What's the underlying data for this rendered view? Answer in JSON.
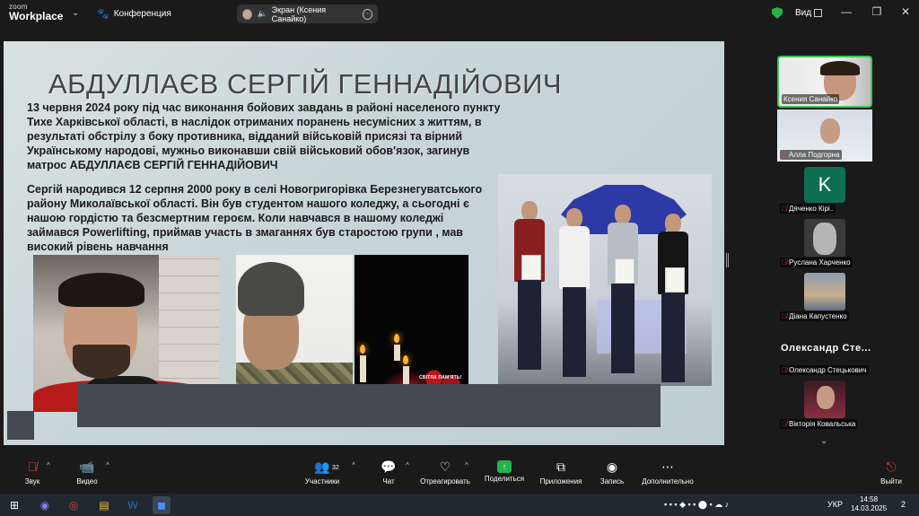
{
  "titlebar": {
    "logo_top": "zoom",
    "logo_bottom": "Workplace",
    "meeting_label": "Конференция",
    "share_label": "Экран (Ксения Санайко)",
    "view_label": "Вид"
  },
  "slide": {
    "title": "АБДУЛЛАЄВ СЕРГІЙ ГЕННАДІЙОВИЧ",
    "paragraph1": "13 червня 2024 року під час виконання бойових завдань в районі населеного пункту Тихе Харківської області,  в наслідок отриманих поранень несумісних з життям, в результаті обстрілу з боку противника, відданий військовій присязі та вірний Українському народові, мужньо виконавши свій військовий обов'язок, загинув матрос АБДУЛЛАЄВ СЕРГІЙ ГЕННАДІЙОВИЧ",
    "paragraph2": "Сергій народився 12 серпня 2000 року в селі Новогригорівка Березнегуватського району Миколаївської області. Він був студентом нашого коледжу, а сьогодні є нашою гордістю та безсмертним героєм. Коли навчався в нашому коледжі займався Powerlifting,  приймав участь в змаганнях був старостою групи , мав високий рівень навчання",
    "memorial_caption": "СВІТЛА ПАМ'ЯТЬ!"
  },
  "participants": [
    {
      "name": "Ксения Санайко",
      "muted": false,
      "active": true
    },
    {
      "name": "Алла Подгорна",
      "muted": true
    },
    {
      "name": "Дяченко Кірі..",
      "muted": true,
      "avatar_letter": "K"
    },
    {
      "name": "Руслана Харченко",
      "muted": true
    },
    {
      "name": "Діана Капустенко",
      "muted": true
    },
    {
      "name": "Олександр Стецькович",
      "muted": true,
      "big_label": "Олександр  Сте..."
    },
    {
      "name": "Вікторія Ковальська",
      "muted": true
    }
  ],
  "toolbar": {
    "audio": "Звук",
    "video": "Видео",
    "participants": "Участники",
    "participants_count": "32",
    "chat": "Чат",
    "react": "Отреагировать",
    "share": "Поделиться",
    "apps": "Приложения",
    "record": "Запись",
    "more": "Дополнительно",
    "exit": "Выйти"
  },
  "taskbar": {
    "lang": "УКР",
    "time": "14:58",
    "date": "14.03.2025",
    "notif_count": "2"
  },
  "colors": {
    "accent_green": "#23b34a",
    "mute_red": "#e23a3a",
    "active_border": "#3ac55b",
    "caption_bar": "#454a52"
  }
}
